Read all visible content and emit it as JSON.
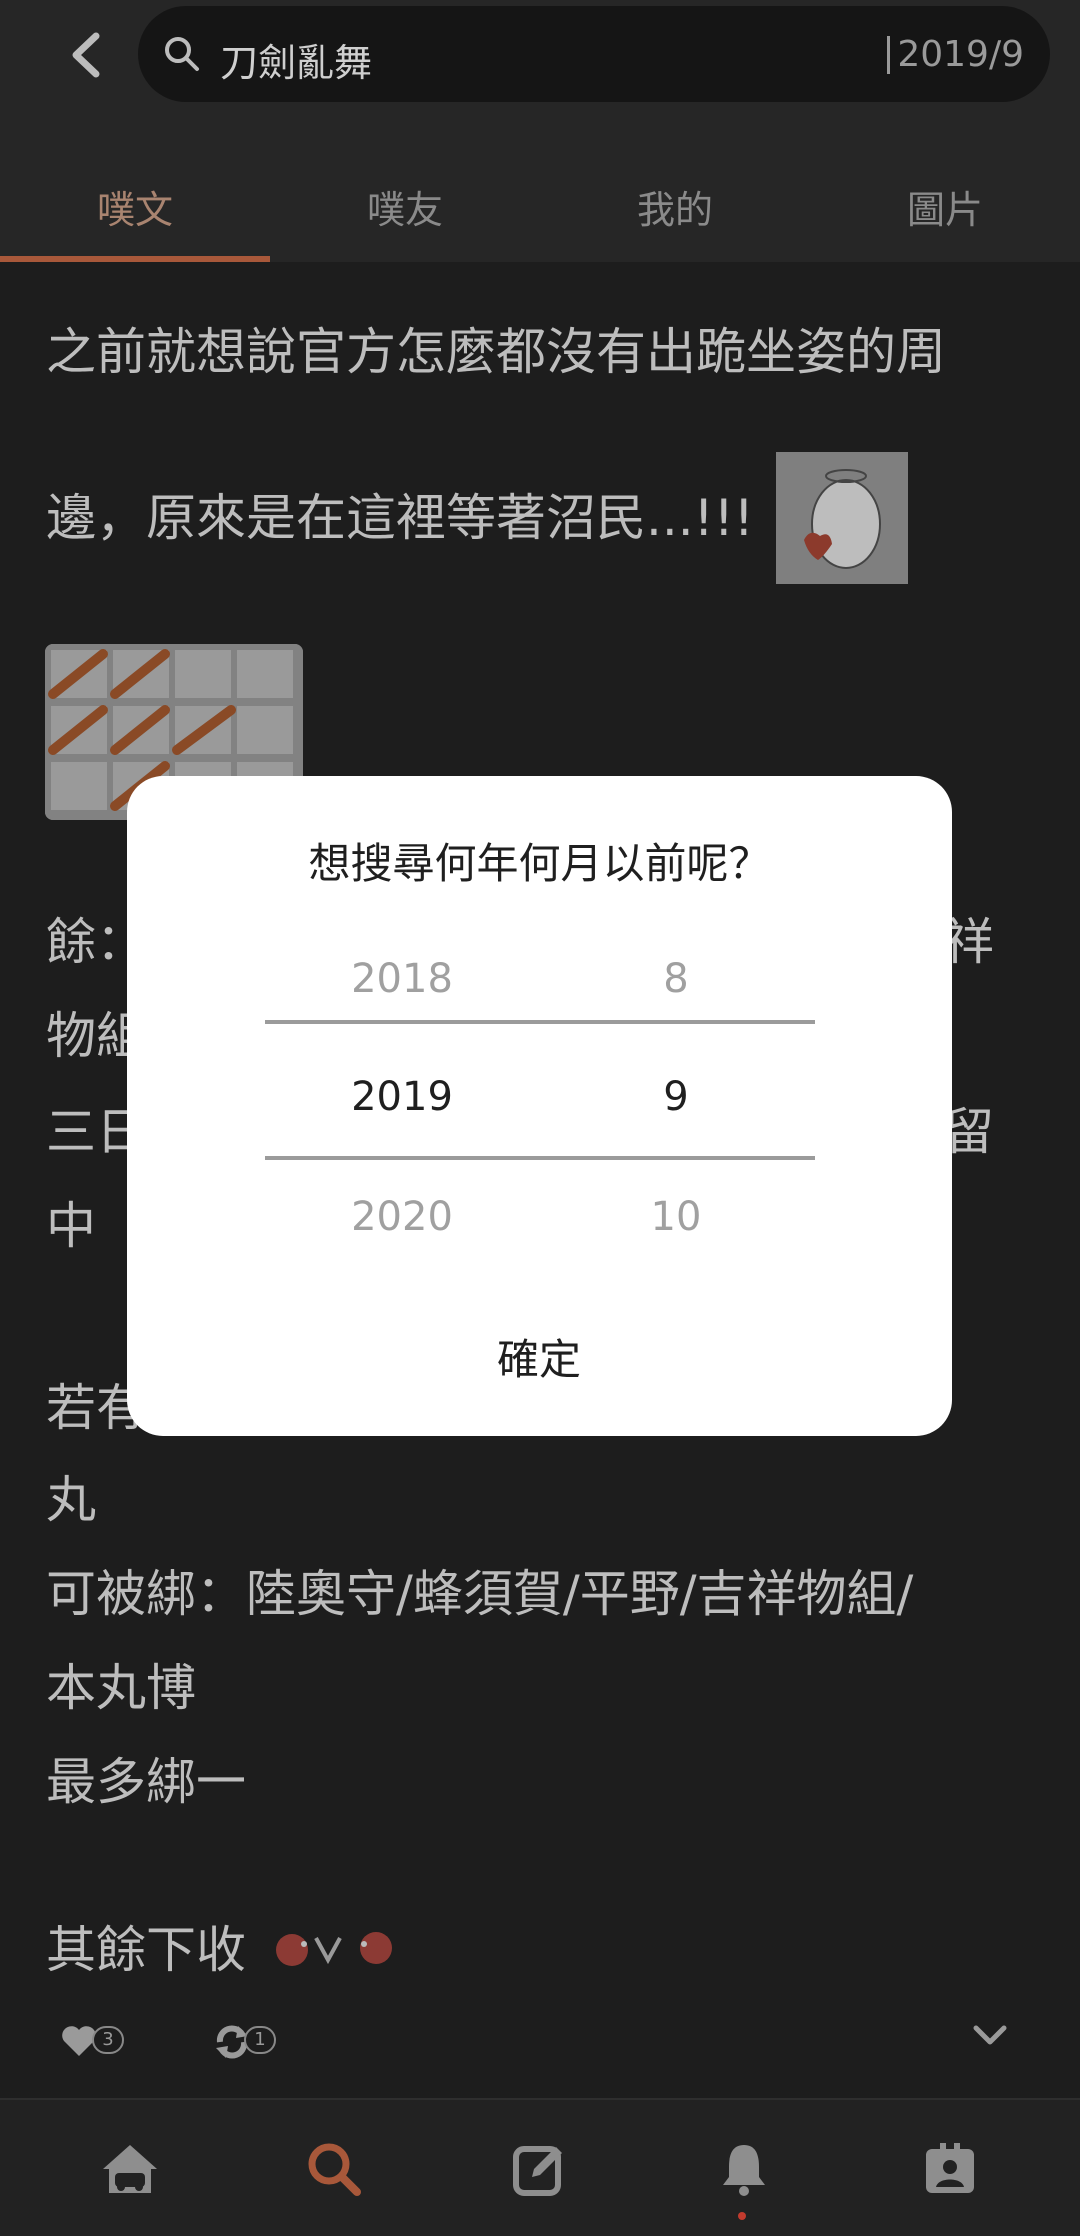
{
  "header": {
    "search_query": "刀劍亂舞",
    "date_filter": "2019/9"
  },
  "tabs": [
    {
      "label": "噗文",
      "active": true
    },
    {
      "label": "噗友",
      "active": false
    },
    {
      "label": "我的",
      "active": false
    },
    {
      "label": "圖片",
      "active": false
    }
  ],
  "post": {
    "lines": [
      "之前就想說官方怎麼都沒有出跪坐姿的周",
      "邊，原來是在這裡等著沼民...!!!",
      "餘：",
      "物組",
      "三日",
      "中",
      "若有",
      "丸",
      "可被綁：陸奧守/蜂須賀/平野/吉祥物組/",
      "本丸博",
      "最多綁一",
      "其餘下收"
    ],
    "right_edge_chars": [
      "祥",
      "留"
    ],
    "like_count": "3",
    "replurk_count": "1"
  },
  "dialog": {
    "title": "想搜尋何年何月以前呢？",
    "years": {
      "prev": "2018",
      "selected": "2019",
      "next": "2020"
    },
    "months": {
      "prev": "8",
      "selected": "9",
      "next": "10"
    },
    "confirm_label": "確定"
  },
  "colors": {
    "accent": "#a8583a",
    "overlay_bg": "#1d1d1d",
    "dialog_bg": "#ffffff",
    "notification_dot": "#c23b2e"
  },
  "bottom_nav": [
    {
      "icon": "home-icon"
    },
    {
      "icon": "search-icon",
      "active": true
    },
    {
      "icon": "compose-icon"
    },
    {
      "icon": "bell-icon",
      "has_badge": true
    },
    {
      "icon": "profile-card-icon"
    }
  ]
}
